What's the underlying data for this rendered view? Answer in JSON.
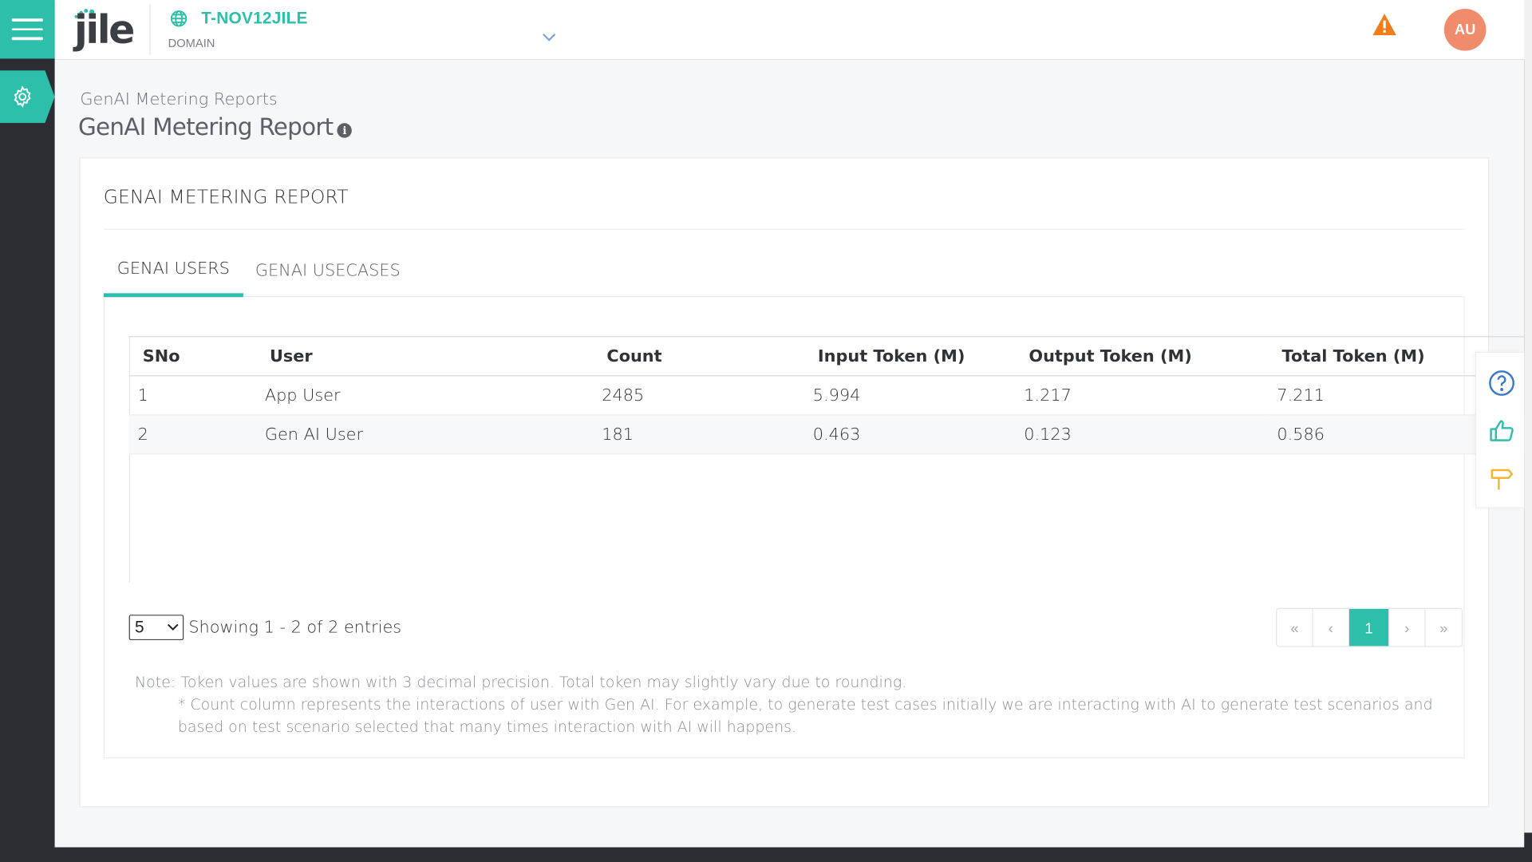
{
  "topbar": {
    "domain_name": "T-NOV12JILE",
    "domain_label": "DOMAIN",
    "logo_text": "jile",
    "avatar_initials": "AU"
  },
  "page": {
    "breadcrumb": "GenAI Metering Reports",
    "title": "GenAI Metering Report"
  },
  "card": {
    "title": "GENAI METERING REPORT",
    "tabs": [
      {
        "label": "GENAI USERS",
        "active": true
      },
      {
        "label": "GENAI USECASES",
        "active": false
      }
    ]
  },
  "table": {
    "headers": [
      "SNo",
      "User",
      "Count",
      "Input Token (M)",
      "Output Token (M)",
      "Total Token (M)"
    ],
    "rows": [
      [
        "1",
        "App User",
        "2485",
        "5.994",
        "1.217",
        "7.211"
      ],
      [
        "2",
        "Gen AI User",
        "181",
        "0.463",
        "0.123",
        "0.586"
      ]
    ]
  },
  "pagination": {
    "page_size": "5",
    "showing": "Showing 1 - 2 of 2 entries",
    "first": "«",
    "prev": "‹",
    "current": "1",
    "next": "›",
    "last": "»"
  },
  "note": {
    "line1": "Note: Token values are shown with 3 decimal precision. Total token may slightly vary due to rounding.",
    "line2": "* Count column represents the interactions of user with Gen AI. For example, to generate test cases initially we are interacting with AI to generate test scenarios and based on test scenario selected that many times interaction with AI will happens."
  },
  "icons": {
    "accent": "#2ebfaa",
    "alert": "#f07d1a",
    "help": "#3a78c9",
    "like": "#2ebfaa",
    "signpost": "#f5b531"
  }
}
